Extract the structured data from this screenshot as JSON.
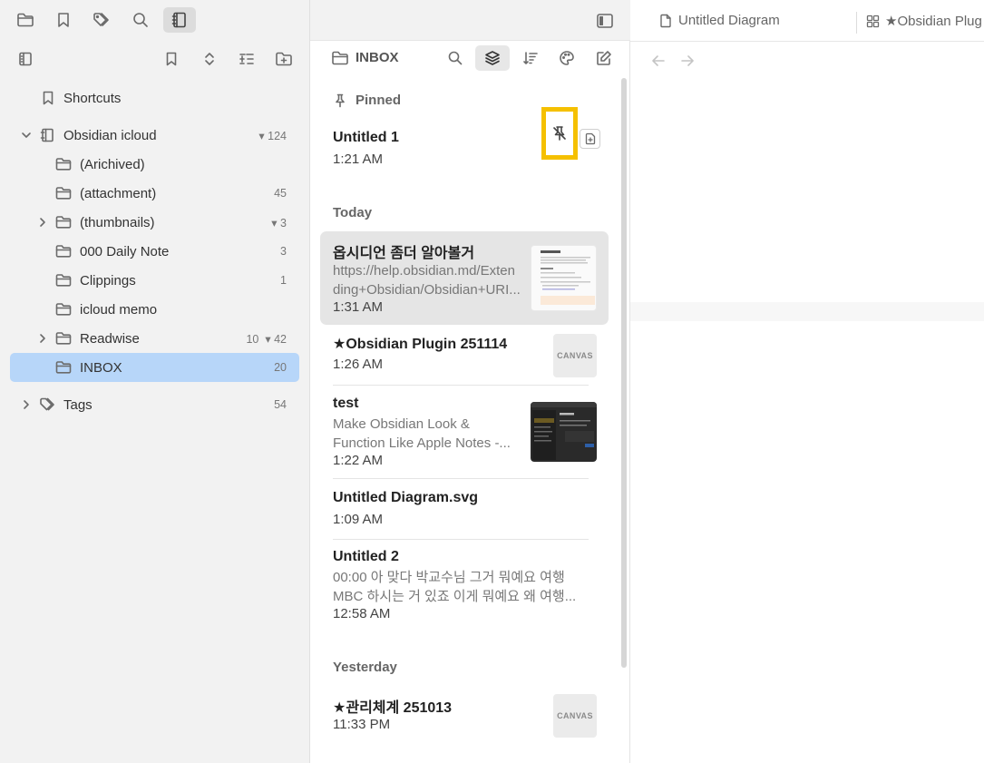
{
  "sidebar": {
    "shortcuts_label": "Shortcuts",
    "vault": {
      "name": "Obsidian icloud",
      "count": "124"
    },
    "folders": [
      {
        "name": "(Arichived)",
        "count": ""
      },
      {
        "name": "(attachment)",
        "count": "45"
      },
      {
        "name": "(thumbnails)",
        "count": "3"
      },
      {
        "name": "000 Daily Note",
        "count": "3"
      },
      {
        "name": "Clippings",
        "count": "1"
      },
      {
        "name": "icloud memo",
        "count": ""
      },
      {
        "name": "Readwise",
        "count": "10",
        "count2": "42"
      },
      {
        "name": "INBOX",
        "count": "20"
      }
    ],
    "tags": {
      "label": "Tags",
      "count": "54"
    }
  },
  "notelist": {
    "folder_title": "INBOX",
    "sections": {
      "pinned": "Pinned",
      "today": "Today",
      "yesterday": "Yesterday"
    },
    "notes": [
      {
        "title": "Untitled 1",
        "time": "1:21 AM"
      },
      {
        "title": "옵시디언 좀더 알아볼거",
        "preview1": "https://help.obsidian.md/Exten",
        "preview2": "ding+Obsidian/Obsidian+URI...",
        "time": "1:31 AM"
      },
      {
        "title": "★Obsidian Plugin 251114",
        "time": "1:26 AM",
        "badge": "CANVAS"
      },
      {
        "title": "test",
        "preview1": "Make Obsidian Look &",
        "preview2": "Function Like Apple Notes -...",
        "time": "1:22 AM"
      },
      {
        "title": "Untitled Diagram.svg",
        "time": "1:09 AM"
      },
      {
        "title": "Untitled 2",
        "preview1": "00:00 아 맞다 박교수님 그거 뭐예요 여행",
        "preview2": "MBC 하시는 거 있죠 이게 뭐예요 왜 여행...",
        "time": "12:58 AM"
      },
      {
        "title": "★관리체계 251013",
        "time": "11:33 PM",
        "badge": "CANVAS"
      }
    ]
  },
  "tabs": [
    {
      "label": "Untitled Diagram"
    },
    {
      "label": "★Obsidian Plug"
    }
  ],
  "colors": {
    "accent_selected": "#b7d6f9",
    "highlight_box": "#f5c000"
  }
}
